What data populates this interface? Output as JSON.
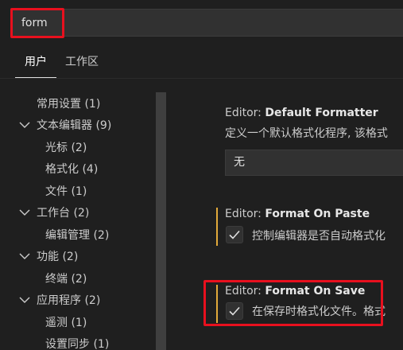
{
  "search": {
    "value": "form"
  },
  "tabs": [
    {
      "label": "用户"
    },
    {
      "label": "工作区"
    }
  ],
  "toc": [
    {
      "label": "常用设置 (1)"
    },
    {
      "label": "文本编辑器 (9)"
    },
    {
      "label": "光标 (2)"
    },
    {
      "label": "格式化 (4)"
    },
    {
      "label": "文件 (1)"
    },
    {
      "label": "工作台 (2)"
    },
    {
      "label": "编辑管理 (2)"
    },
    {
      "label": "功能 (2)"
    },
    {
      "label": "终端 (2)"
    },
    {
      "label": "应用程序 (2)"
    },
    {
      "label": "遥测 (1)"
    },
    {
      "label": "设置同步 (1)"
    }
  ],
  "settings": {
    "default_formatter": {
      "prefix": "Editor: ",
      "name": "Default Formatter",
      "description": "定义一个默认格式化程序, 该格式",
      "value": "无"
    },
    "format_on_paste": {
      "prefix": "Editor: ",
      "name": "Format On Paste",
      "description": "控制编辑器是否自动格式化"
    },
    "format_on_save": {
      "prefix": "Editor: ",
      "name": "Format On Save",
      "description": "在保存时格式化文件。格式"
    }
  },
  "colors": {
    "highlight": "#e8101e",
    "modified": "#e2a93a",
    "background": "#1f1f1f"
  }
}
